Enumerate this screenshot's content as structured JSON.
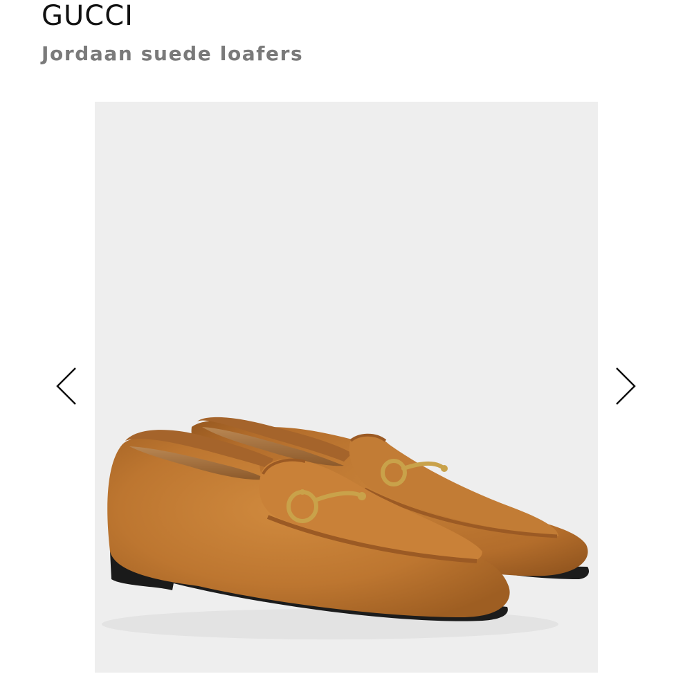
{
  "product": {
    "brand": "GUCCI",
    "name": "Jordaan suede loafers"
  },
  "gallery": {
    "image_alt": "Jordaan suede loafers",
    "prev_icon": "chevron-left-icon",
    "next_icon": "chevron-right-icon"
  },
  "colors": {
    "suede": "#c07a33",
    "leather_trim": "#a5642b",
    "horsebit": "#c9a24a",
    "sole": "#1c1c1c",
    "background": "#eeeeee"
  }
}
